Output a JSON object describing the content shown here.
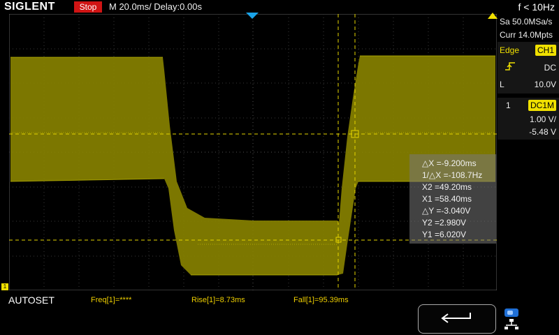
{
  "header": {
    "brand": "SIGLENT",
    "run_state": "Stop",
    "timebase": "M 20.0ms/ Delay:0.00s",
    "trigger_freq": "f < 10Hz"
  },
  "acquisition": {
    "sample_rate": "Sa 50.0MSa/s",
    "memory_depth": "Curr 14.0Mpts"
  },
  "trigger": {
    "type": "Edge",
    "source": "CH1",
    "coupling": "DC",
    "level_label": "L",
    "level": "10.0V"
  },
  "channel": {
    "number": "1",
    "coupling": "DC1M",
    "scale": "1.00 V/",
    "offset": "-5.48 V"
  },
  "cursors": {
    "delta_x": "△X =-9.200ms",
    "inv_delta_x": "1/△X =-108.7Hz",
    "x2": "X2 =49.20ms",
    "x1": "X1 =58.40ms",
    "delta_y": "△Y =-3.040V",
    "y2": "Y2 =2.980V",
    "y1": "Y1 =6.020V"
  },
  "bottom": {
    "autoset": "AUTOSET",
    "freq": "Freq[1]=****",
    "rise": "Rise[1]=8.73ms",
    "fall": "Fall[1]=95.39ms"
  },
  "colors": {
    "trace": "#b8b000",
    "cursor": "#e6d600",
    "trigger_marker": "#1aa3e8"
  }
}
